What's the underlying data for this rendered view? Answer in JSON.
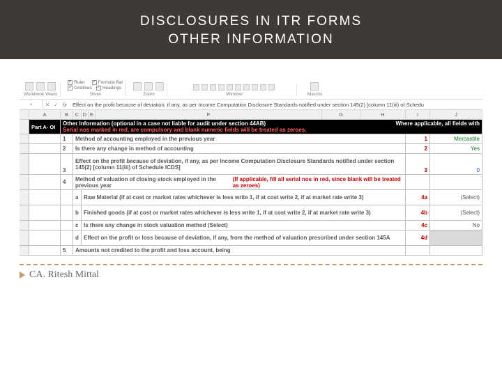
{
  "title": {
    "line1": "DISCLOSURES IN ITR FORMS",
    "line2": "OTHER INFORMATION"
  },
  "ribbon": {
    "views": {
      "items": [
        "Page Break Preview",
        "Page Layout",
        "Custom Views"
      ],
      "group": "Workbook Views"
    },
    "show": {
      "ruler": "Ruler",
      "formula": "Formula Bar",
      "grid": "Gridlines",
      "headings": "Headings",
      "group": "Show"
    },
    "zoom": {
      "zoom": "Zoom",
      "hundred": "100%",
      "sel": "Zoom to Selection",
      "group": "Zoom"
    },
    "window": {
      "newwin": "New Window",
      "arrange": "Arrange All",
      "freeze": "Freeze Panes",
      "split": "Split",
      "hide": "Hide",
      "unhide": "Unhide",
      "sbs": "View Side by Side",
      "sync": "Synchronous Scrolling",
      "reset": "Reset Window Position",
      "switch": "Switch Windows",
      "group": "Window"
    },
    "macros": {
      "label": "Macros",
      "group": "Macros"
    }
  },
  "formulabar": {
    "name": "",
    "fx": "fx",
    "text": "Effect on the profit  because of deviation, if any,  as per Income Computation Disclosure Standards notified under section 145(2) [column 11(iii) of Schedu"
  },
  "cols": {
    "rownum": "",
    "A": "A",
    "B": "B",
    "C": "C",
    "D": "D",
    "E": "E",
    "F": "F",
    "G": "G",
    "H": "H",
    "I": "I",
    "J": "J"
  },
  "sheet": {
    "partA": "Part A- OI",
    "header": {
      "l1": "Other Information (optional in a case not liable for audit under section 44AB)",
      "l1r": "Where applicable, all fields with",
      "l2": "Serial nos marked in red, are compulsory and blank numeric fields will be treated as zeroes."
    },
    "rows": [
      {
        "num": "1",
        "text": "Method of accounting employed in the previous year",
        "code": "1",
        "val": "Mercantile"
      },
      {
        "num": "2",
        "text": "Is there any change in method of accounting",
        "code": "2",
        "val": "Yes"
      },
      {
        "num": "",
        "text": "Effect on the profit  because of deviation, if any,  as per Income Computation Disclosure Standards notified under section 145(2) [column 11(iii) of Schedule ICDS]",
        "code": "3",
        "val": "0",
        "multi": true,
        "lead": "3"
      },
      {
        "num": "4",
        "text": "Method of valuation of closing stock employed in the previous year",
        "note": "(If applicable, fill all serial nos in red, since blank will be treated as zeroes)",
        "code": "",
        "val": ""
      }
    ],
    "sub": [
      {
        "l": "a",
        "text": "Raw Material (if at cost or market rates whichever is less write 1, if at cost write 2, if at market rate write 3)",
        "code": "4a",
        "val": "(Select)"
      },
      {
        "l": "b",
        "text": "Finished goods (if at cost or market rates whichever is less write 1, if at cost write 2, if at market rate write 3)",
        "code": "4b",
        "val": "(Select)"
      },
      {
        "l": "c",
        "text": "Is there any change in stock valuation method (Select)",
        "code": "4c",
        "val": "No"
      },
      {
        "l": "d",
        "text": "Effect on the profit or loss because of deviation, if any, from the method of valuation prescribed under section 145A",
        "code": "4d",
        "val": "",
        "grey": true
      }
    ],
    "row5": {
      "num": "5",
      "text": "Amounts not credited to the profit and loss account, being"
    }
  },
  "footer": {
    "author": "CA. Ritesh Mittal"
  }
}
